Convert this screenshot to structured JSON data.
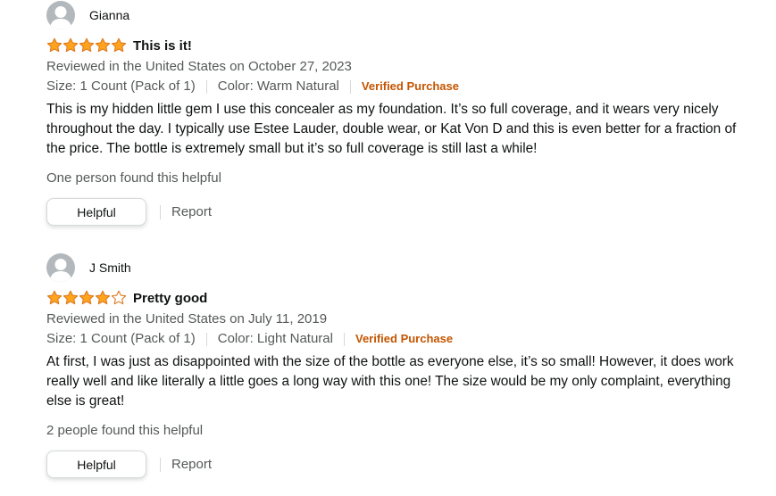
{
  "colors": {
    "star_fill": "#ffa41c",
    "star_stroke": "#de7921",
    "verified": "#c45500",
    "muted_text": "#565959",
    "body_text": "#0f1111",
    "avatar_bg": "#b3b8bc"
  },
  "reviews": [
    {
      "profile_name": "Gianna",
      "rating": 5,
      "rating_max": 5,
      "title": "This is it!",
      "date": "Reviewed in the United States on October 27, 2023",
      "size": "Size: 1 Count (Pack of 1)",
      "color": "Color: Warm Natural",
      "verified": "Verified Purchase",
      "body": "This is my hidden little gem I use this concealer as my foundation. It’s so full coverage, and it wears very nicely throughout the day. I typically use Estee Lauder, double wear, or Kat Von D and this is even better for a fraction of the price. The bottle is extremely small but it’s so full coverage is still last a while!",
      "helpful_count": "One person found this helpful",
      "helpful_label": "Helpful",
      "report_label": "Report"
    },
    {
      "profile_name": "J Smith",
      "rating": 4,
      "rating_max": 5,
      "title": "Pretty good",
      "date": "Reviewed in the United States on July 11, 2019",
      "size": "Size: 1 Count (Pack of 1)",
      "color": "Color: Light Natural",
      "verified": "Verified Purchase",
      "body": "At first, I was just as disappointed with the size of the bottle as everyone else, it’s so small! However, it does work really well and like literally a little goes a long way with this one! The size would be my only complaint, everything else is great!",
      "helpful_count": "2 people found this helpful",
      "helpful_label": "Helpful",
      "report_label": "Report"
    }
  ]
}
